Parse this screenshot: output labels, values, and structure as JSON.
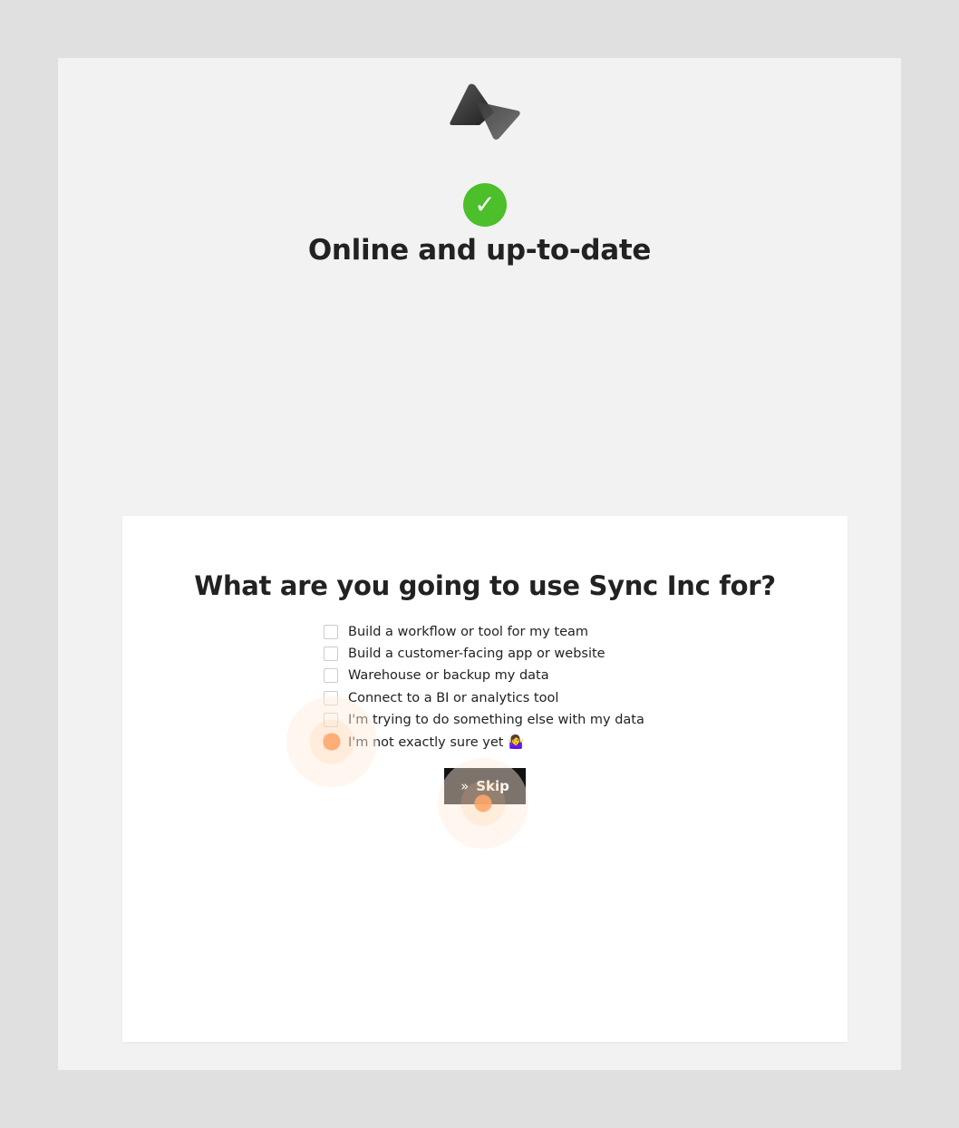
{
  "status": {
    "title": "Online and up-to-date",
    "icon": "check-circle-icon",
    "icon_glyph": "✓",
    "color": "#4cbf2a"
  },
  "logo": {
    "icon": "sync-inc-logo-icon"
  },
  "survey": {
    "question": "What are you going to use Sync Inc for?",
    "options": [
      {
        "label": "Build a workflow or tool for my team"
      },
      {
        "label": "Build a customer-facing app or website"
      },
      {
        "label": "Warehouse or backup my data"
      },
      {
        "label": "Connect to a BI or analytics tool"
      },
      {
        "label": "I'm trying to do something else with my data"
      },
      {
        "label": "I'm not exactly sure yet 🤷‍♀️"
      }
    ],
    "skip_label": "Skip",
    "skip_icon": "double-chevron-right-icon",
    "skip_glyph": "»"
  },
  "colors": {
    "background": "#e0e0e0",
    "panel": "#f2f2f2",
    "card": "#ffffff",
    "button": "#111111",
    "click_marker": "#ffaa6e"
  }
}
